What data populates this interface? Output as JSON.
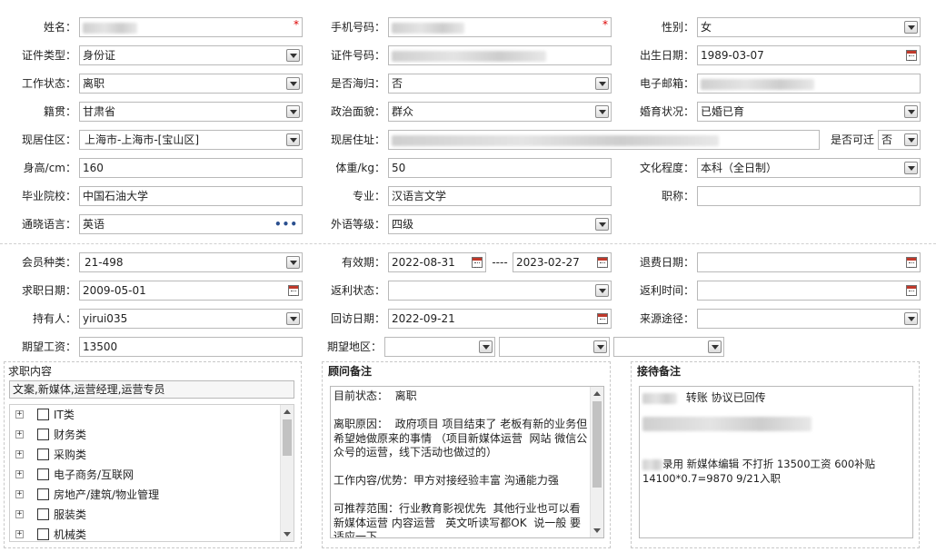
{
  "rows": {
    "r1": {
      "name_label": "姓名：",
      "phone_label": "手机号码：",
      "gender_label": "性别：",
      "gender_value": "女",
      "required_mark": "*"
    },
    "r2": {
      "id_type_label": "证件类型：",
      "id_type_value": "身份证",
      "id_no_label": "证件号码：",
      "birth_label": "出生日期：",
      "birth_value": "1989-03-07"
    },
    "r3": {
      "work_status_label": "工作状态：",
      "work_status_value": "离职",
      "overseas_label": "是否海归：",
      "overseas_value": "否",
      "email_label": "电子邮箱："
    },
    "r4": {
      "native_label": "籍贯：",
      "native_value": "甘肃省",
      "political_label": "政治面貌：",
      "political_value": "群众",
      "marital_label": "婚育状况：",
      "marital_value": "已婚已育"
    },
    "r5": {
      "residence_label": "现居住区：",
      "residence_value": "上海市-上海市-[宝山区]",
      "address_label": "现居住址：",
      "relocate_label": "是否可迁",
      "relocate_value": "否"
    },
    "r6": {
      "height_label": "身高/cm：",
      "height_value": "160",
      "weight_label": "体重/kg：",
      "weight_value": "50",
      "education_label": "文化程度：",
      "education_value": "本科（全日制）"
    },
    "r7": {
      "school_label": "毕业院校：",
      "school_value": "中国石油大学",
      "major_label": "专业：",
      "major_value": "汉语言文学",
      "title_label": "职称："
    },
    "r8": {
      "language_label": "通晓语言：",
      "language_value": "英语",
      "lang_level_label": "外语等级：",
      "lang_level_value": "四级",
      "more_glyph": "•••"
    },
    "r9": {
      "member_label": "会员种类：",
      "member_value": "21-498",
      "valid_label": "有效期：",
      "valid_from": "2022-08-31",
      "valid_sep": "----",
      "valid_to": "2023-02-27",
      "refund_label": "退费日期："
    },
    "r10": {
      "apply_date_label": "求职日期：",
      "apply_date_value": "2009-05-01",
      "rebate_status_label": "返利状态：",
      "rebate_time_label": "返利时间："
    },
    "r11": {
      "holder_label": "持有人：",
      "holder_value": "yirui035",
      "visit_label": "回访日期：",
      "visit_value": "2022-09-21",
      "source_label": "来源途径："
    },
    "r12": {
      "salary_label": "期望工资：",
      "salary_value": "13500",
      "region_label": "期望地区："
    }
  },
  "job_panel": {
    "title": "求职内容",
    "summary": "文案,新媒体,运营经理,运营专员",
    "expander_glyph": "+",
    "tree": [
      "IT类",
      "财务类",
      "采购类",
      "电子商务/互联网",
      "房地产/建筑/物业管理",
      "服装类",
      "机械类"
    ]
  },
  "advisor_panel": {
    "title": "顾问备注",
    "lines": [
      "目前状态：  离职",
      "",
      "离职原因：  政府项目 项目结束了 老板有新的业务但希望她做原来的事情 （项目新媒体运营  网站 微信公众号的运营，线下活动也做过的）",
      "",
      "工作内容/优势：甲方对接经验丰富 沟通能力强",
      "",
      "可推荐范围：行业教育影视优先  其他行业也可以看 新媒体运营 内容运营   英文听读写都OK  说一般 要适应一下"
    ]
  },
  "reception_panel": {
    "title": "接待备注",
    "line1": "转账 协议已回传",
    "line3": "录用  新媒体编辑  不打折  13500工资 600补贴",
    "line4": "14100*0.7=9870  9/21入职"
  }
}
